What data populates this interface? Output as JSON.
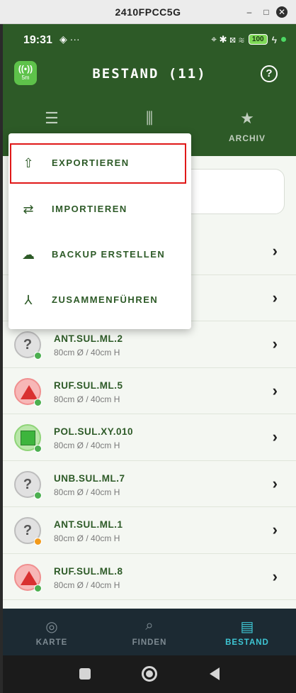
{
  "window": {
    "title": "2410FPCC5G",
    "min": "–",
    "max": "□",
    "close": "✕"
  },
  "statusbar": {
    "time": "19:31",
    "left_icons": "◈ ···",
    "battery": "100",
    "bolt": "ϟ",
    "icons": "⌖ ✱ ⊠ ≋"
  },
  "header": {
    "gps_badge_top": "((•))",
    "gps_badge_bottom": "5m",
    "title": "BESTAND (11)",
    "help_glyph": "?"
  },
  "tabs": [
    {
      "icon": "☰",
      "label": ""
    },
    {
      "icon": "⫼",
      "label": ""
    },
    {
      "icon": "★",
      "label": "ARCHIV"
    }
  ],
  "menu": {
    "items": [
      {
        "icon": "⇧",
        "label": "EXPORTIEREN"
      },
      {
        "icon": "⇄",
        "label": "IMPORTIEREN"
      },
      {
        "icon": "☁",
        "label": "BACKUP ERSTELLEN"
      },
      {
        "icon": "⅄",
        "label": "ZUSAMMENFÜHREN"
      }
    ]
  },
  "list": {
    "chevron": "›",
    "rows": [
      {
        "name": "",
        "sub": ""
      },
      {
        "name": "",
        "sub": ""
      },
      {
        "name": "ANT.SUL.ML.2",
        "sub": "80cm Ø / 40cm H",
        "avatar": "unknown",
        "status": "ok",
        "q": "?"
      },
      {
        "name": "RUF.SUL.ML.5",
        "sub": "80cm Ø / 40cm H",
        "avatar": "triangle",
        "status": "ok"
      },
      {
        "name": "POL.SUL.XY.010",
        "sub": "80cm Ø / 40cm H",
        "avatar": "square",
        "status": "ok"
      },
      {
        "name": "UNB.SUL.ML.7",
        "sub": "80cm Ø / 40cm H",
        "avatar": "unknown",
        "status": "ok",
        "q": "?"
      },
      {
        "name": "ANT.SUL.ML.1",
        "sub": "80cm Ø / 40cm H",
        "avatar": "unknown",
        "status": "warn",
        "q": "?"
      },
      {
        "name": "RUF.SUL.ML.8",
        "sub": "80cm Ø / 40cm H",
        "avatar": "triangle",
        "status": "ok"
      }
    ]
  },
  "bottomnav": [
    {
      "icon": "◎",
      "label": "KARTE"
    },
    {
      "icon": "⌕",
      "label": "FINDEN"
    },
    {
      "icon": "▤",
      "label": "BESTAND",
      "active": true
    }
  ],
  "colors": {
    "primary": "#2d5a27",
    "accent": "#3ec6d4",
    "highlight": "#e01818"
  }
}
